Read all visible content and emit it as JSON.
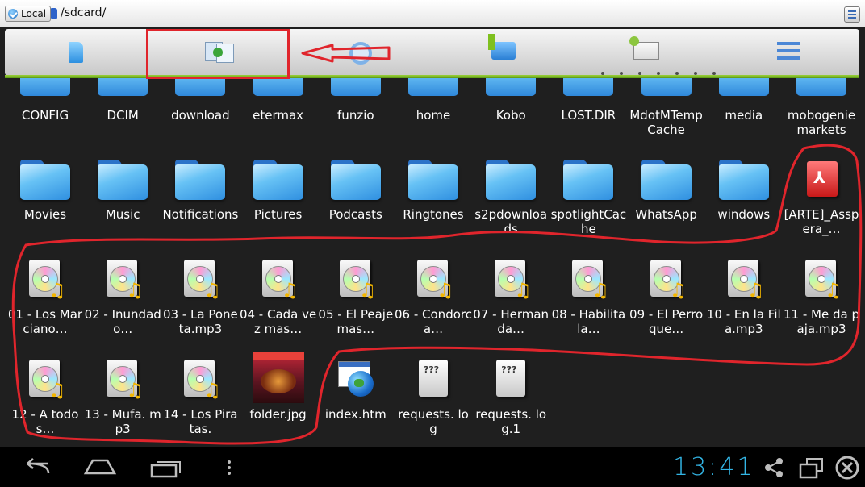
{
  "pathbar": {
    "location_label": "Local",
    "path": "/sdcard/"
  },
  "toolbar": {
    "tools": [
      {
        "icon": "sdcard-icon"
      },
      {
        "icon": "add-copy-icon"
      },
      {
        "icon": "search-icon"
      },
      {
        "icon": "up-folder-icon"
      },
      {
        "icon": "window-settings-icon"
      },
      {
        "icon": "list-view-icon"
      }
    ]
  },
  "files": [
    {
      "label": "CONFIG",
      "type": "folder"
    },
    {
      "label": "DCIM",
      "type": "folder"
    },
    {
      "label": "download",
      "type": "folder"
    },
    {
      "label": "etermax",
      "type": "folder"
    },
    {
      "label": "funzio",
      "type": "folder"
    },
    {
      "label": "home",
      "type": "folder"
    },
    {
      "label": "Kobo",
      "type": "folder"
    },
    {
      "label": "LOST.DIR",
      "type": "folder"
    },
    {
      "label": "MdotMTempCache",
      "type": "folder"
    },
    {
      "label": "media",
      "type": "folder"
    },
    {
      "label": "mobogenie markets",
      "type": "folder"
    },
    {
      "label": "Movies",
      "type": "folder"
    },
    {
      "label": "Music",
      "type": "folder"
    },
    {
      "label": "Notifications",
      "type": "folder"
    },
    {
      "label": "Pictures",
      "type": "folder"
    },
    {
      "label": "Podcasts",
      "type": "folder"
    },
    {
      "label": "Ringtones",
      "type": "folder"
    },
    {
      "label": "s2pdownloads",
      "type": "folder"
    },
    {
      "label": "spotlightCache",
      "type": "folder"
    },
    {
      "label": "WhatsApp",
      "type": "folder"
    },
    {
      "label": "windows",
      "type": "folder"
    },
    {
      "label": "[ARTE]_Asspera_…",
      "type": "pdf"
    },
    {
      "label": "01 - Los Marciano…",
      "type": "audio"
    },
    {
      "label": "02 - Inundado…",
      "type": "audio"
    },
    {
      "label": "03 - La Poneta.mp3",
      "type": "audio"
    },
    {
      "label": "04 - Cada vez mas…",
      "type": "audio"
    },
    {
      "label": "05 - El Peaje mas…",
      "type": "audio"
    },
    {
      "label": "06 - Condorca…",
      "type": "audio"
    },
    {
      "label": "07 - Hermanda…",
      "type": "audio"
    },
    {
      "label": "08 - Habilita la…",
      "type": "audio"
    },
    {
      "label": "09 - El Perro que…",
      "type": "audio"
    },
    {
      "label": "10 - En la Fila.mp3",
      "type": "audio"
    },
    {
      "label": "11 - Me da paja.mp3",
      "type": "audio"
    },
    {
      "label": "12 - A todos…",
      "type": "audio"
    },
    {
      "label": "13 - Mufa. mp3",
      "type": "audio"
    },
    {
      "label": "14 - Los Piratas.",
      "type": "audio"
    },
    {
      "label": "folder.jpg",
      "type": "image"
    },
    {
      "label": "index.htm",
      "type": "html"
    },
    {
      "label": "requests. log",
      "type": "text"
    },
    {
      "label": "requests. log.1",
      "type": "text"
    }
  ],
  "status": {
    "clock": "13:41"
  },
  "colors": {
    "annotation": "#e0252c",
    "clock": "#33b5e5",
    "toolbar_accent": "#7fc01f"
  }
}
